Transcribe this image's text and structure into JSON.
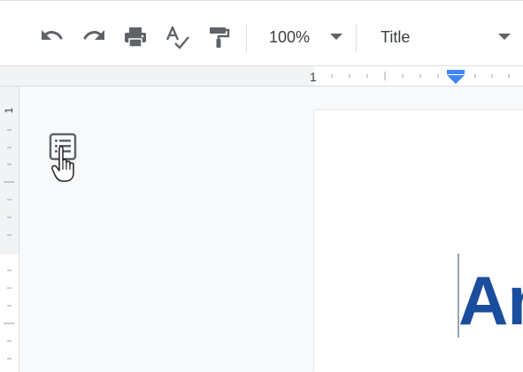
{
  "toolbar": {
    "zoom_value": "100%",
    "style_value": "Title",
    "icons": [
      "undo-icon",
      "redo-icon",
      "print-icon",
      "spellcheck-icon",
      "paint-format-icon"
    ]
  },
  "ruler": {
    "horizontal_number": "1",
    "vertical_number": "1"
  },
  "document": {
    "title_visible": "An"
  },
  "colors": {
    "title": "#1a4d9e",
    "indent_marker": "#4285f4",
    "icon_gray": "#5f6368"
  }
}
